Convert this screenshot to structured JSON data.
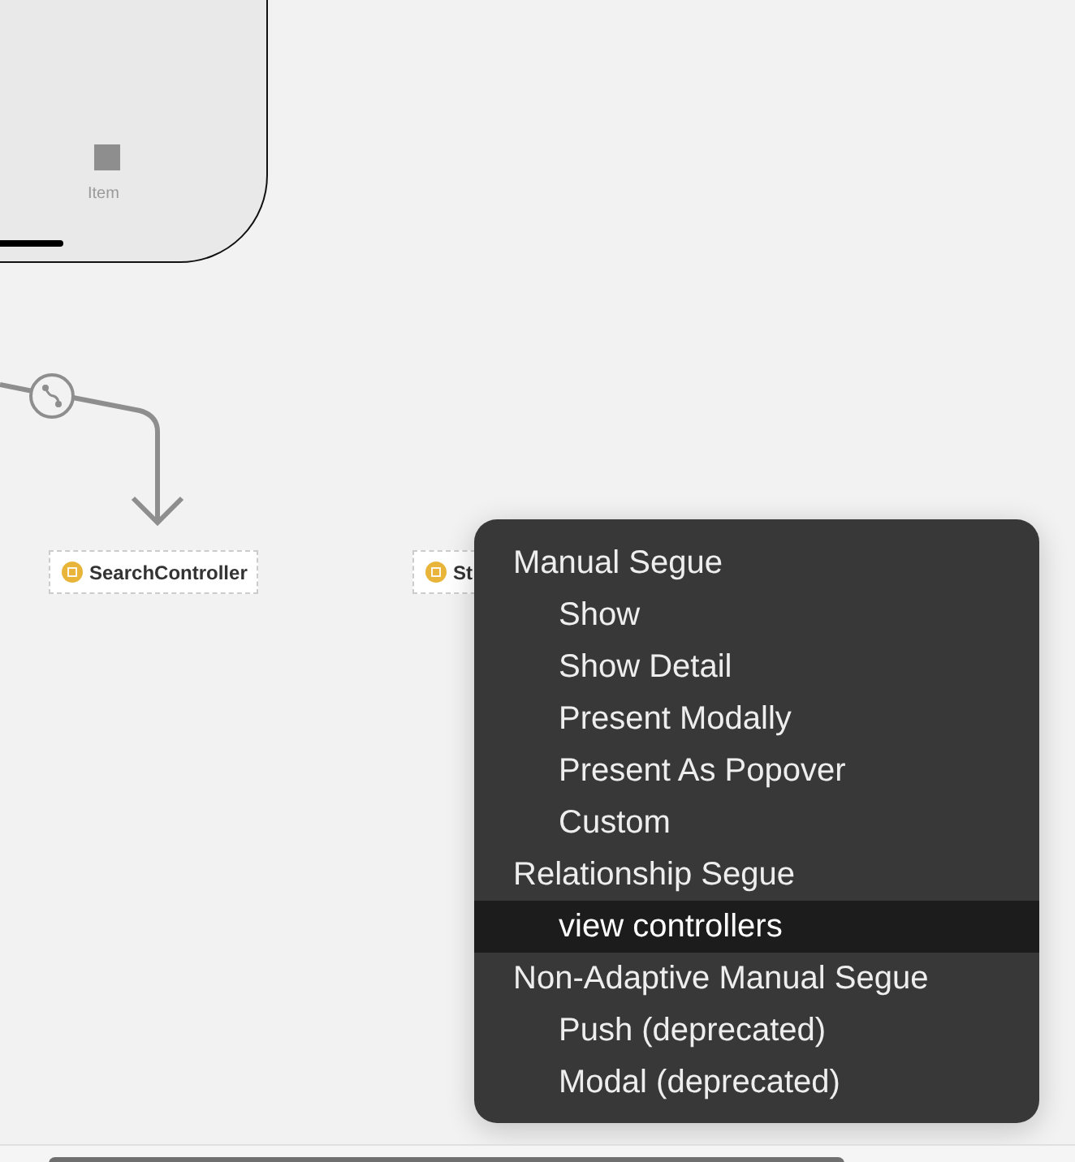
{
  "canvas": {
    "phone_scene": {
      "tab_item": {
        "label": "Item"
      }
    },
    "scenes": [
      {
        "label": "SearchController"
      },
      {
        "label": "St"
      }
    ]
  },
  "context_menu": {
    "items": [
      {
        "kind": "header",
        "label": "Manual Segue",
        "selected": false
      },
      {
        "kind": "option",
        "label": "Show",
        "selected": false
      },
      {
        "kind": "option",
        "label": "Show Detail",
        "selected": false
      },
      {
        "kind": "option",
        "label": "Present Modally",
        "selected": false
      },
      {
        "kind": "option",
        "label": "Present As Popover",
        "selected": false
      },
      {
        "kind": "option",
        "label": "Custom",
        "selected": false
      },
      {
        "kind": "header",
        "label": "Relationship Segue",
        "selected": false
      },
      {
        "kind": "option",
        "label": "view controllers",
        "selected": true
      },
      {
        "kind": "header",
        "label": "Non-Adaptive Manual Segue",
        "selected": false
      },
      {
        "kind": "option",
        "label": "Push (deprecated)",
        "selected": false
      },
      {
        "kind": "option",
        "label": "Modal (deprecated)",
        "selected": false
      }
    ]
  }
}
